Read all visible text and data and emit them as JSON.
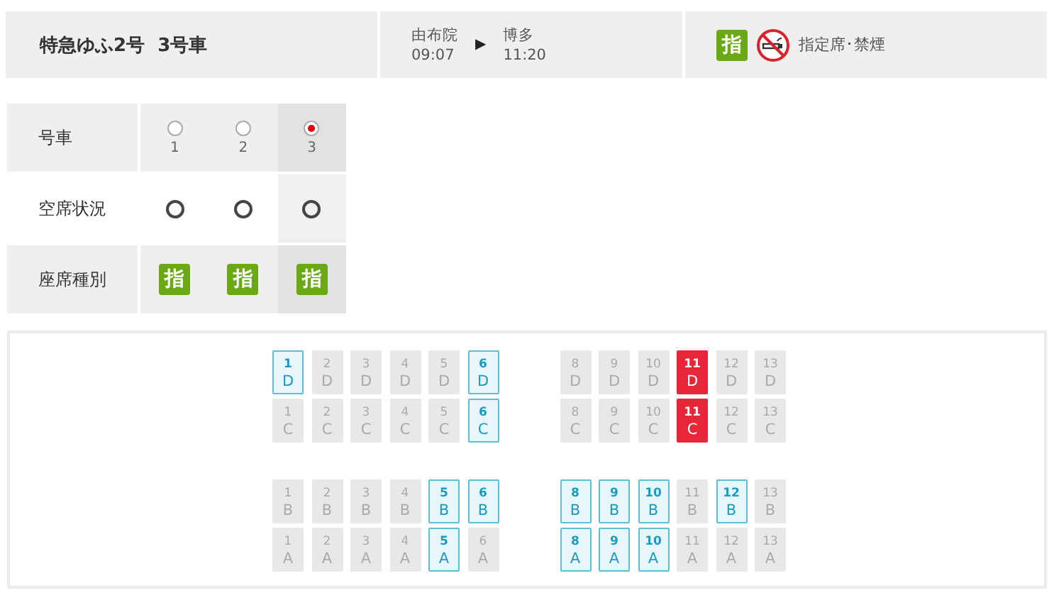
{
  "header": {
    "title": "特急ゆふ2号  3号車",
    "from": {
      "station": "由布院",
      "time": "09:07"
    },
    "to": {
      "station": "博多",
      "time": "11:20"
    },
    "arrow": "▶",
    "seat_badge": "指",
    "no_smoking": true,
    "seat_note": "指定席･禁煙"
  },
  "cars": {
    "row_labels": [
      "号車",
      "空席状況",
      "座席種別"
    ],
    "items": [
      {
        "number": "1",
        "selected": false,
        "vacant": true,
        "seat_type": "指"
      },
      {
        "number": "2",
        "selected": false,
        "vacant": true,
        "seat_type": "指"
      },
      {
        "number": "3",
        "selected": true,
        "vacant": true,
        "seat_type": "指"
      }
    ]
  },
  "seat_map": {
    "upper_rows": [
      {
        "left": [
          {
            "number": "1",
            "letter": "D",
            "available": true,
            "selected": false
          },
          {
            "number": "2",
            "letter": "D",
            "available": false,
            "selected": false
          },
          {
            "number": "3",
            "letter": "D",
            "available": false,
            "selected": false
          },
          {
            "number": "4",
            "letter": "D",
            "available": false,
            "selected": false
          },
          {
            "number": "5",
            "letter": "D",
            "available": false,
            "selected": false
          },
          {
            "number": "6",
            "letter": "D",
            "available": true,
            "selected": false
          }
        ],
        "right": [
          {
            "number": "8",
            "letter": "D",
            "available": false,
            "selected": false
          },
          {
            "number": "9",
            "letter": "D",
            "available": false,
            "selected": false
          },
          {
            "number": "10",
            "letter": "D",
            "available": false,
            "selected": false
          },
          {
            "number": "11",
            "letter": "D",
            "available": false,
            "selected": true
          },
          {
            "number": "12",
            "letter": "D",
            "available": false,
            "selected": false
          },
          {
            "number": "13",
            "letter": "D",
            "available": false,
            "selected": false
          }
        ]
      },
      {
        "left": [
          {
            "number": "1",
            "letter": "C",
            "available": false,
            "selected": false
          },
          {
            "number": "2",
            "letter": "C",
            "available": false,
            "selected": false
          },
          {
            "number": "3",
            "letter": "C",
            "available": false,
            "selected": false
          },
          {
            "number": "4",
            "letter": "C",
            "available": false,
            "selected": false
          },
          {
            "number": "5",
            "letter": "C",
            "available": false,
            "selected": false
          },
          {
            "number": "6",
            "letter": "C",
            "available": true,
            "selected": false
          }
        ],
        "right": [
          {
            "number": "8",
            "letter": "C",
            "available": false,
            "selected": false
          },
          {
            "number": "9",
            "letter": "C",
            "available": false,
            "selected": false
          },
          {
            "number": "10",
            "letter": "C",
            "available": false,
            "selected": false
          },
          {
            "number": "11",
            "letter": "C",
            "available": false,
            "selected": true
          },
          {
            "number": "12",
            "letter": "C",
            "available": false,
            "selected": false
          },
          {
            "number": "13",
            "letter": "C",
            "available": false,
            "selected": false
          }
        ]
      }
    ],
    "lower_rows": [
      {
        "left": [
          {
            "number": "1",
            "letter": "B",
            "available": false,
            "selected": false
          },
          {
            "number": "2",
            "letter": "B",
            "available": false,
            "selected": false
          },
          {
            "number": "3",
            "letter": "B",
            "available": false,
            "selected": false
          },
          {
            "number": "4",
            "letter": "B",
            "available": false,
            "selected": false
          },
          {
            "number": "5",
            "letter": "B",
            "available": true,
            "selected": false
          },
          {
            "number": "6",
            "letter": "B",
            "available": true,
            "selected": false
          }
        ],
        "right": [
          {
            "number": "8",
            "letter": "B",
            "available": true,
            "selected": false
          },
          {
            "number": "9",
            "letter": "B",
            "available": true,
            "selected": false
          },
          {
            "number": "10",
            "letter": "B",
            "available": true,
            "selected": false
          },
          {
            "number": "11",
            "letter": "B",
            "available": false,
            "selected": false
          },
          {
            "number": "12",
            "letter": "B",
            "available": true,
            "selected": false
          },
          {
            "number": "13",
            "letter": "B",
            "available": false,
            "selected": false
          }
        ]
      },
      {
        "left": [
          {
            "number": "1",
            "letter": "A",
            "available": false,
            "selected": false
          },
          {
            "number": "2",
            "letter": "A",
            "available": false,
            "selected": false
          },
          {
            "number": "3",
            "letter": "A",
            "available": false,
            "selected": false
          },
          {
            "number": "4",
            "letter": "A",
            "available": false,
            "selected": false
          },
          {
            "number": "5",
            "letter": "A",
            "available": true,
            "selected": false
          },
          {
            "number": "6",
            "letter": "A",
            "available": false,
            "selected": false
          }
        ],
        "right": [
          {
            "number": "8",
            "letter": "A",
            "available": true,
            "selected": false
          },
          {
            "number": "9",
            "letter": "A",
            "available": true,
            "selected": false
          },
          {
            "number": "10",
            "letter": "A",
            "available": true,
            "selected": false
          },
          {
            "number": "11",
            "letter": "A",
            "available": false,
            "selected": false
          },
          {
            "number": "12",
            "letter": "A",
            "available": false,
            "selected": false
          },
          {
            "number": "13",
            "letter": "A",
            "available": false,
            "selected": false
          }
        ]
      }
    ]
  }
}
